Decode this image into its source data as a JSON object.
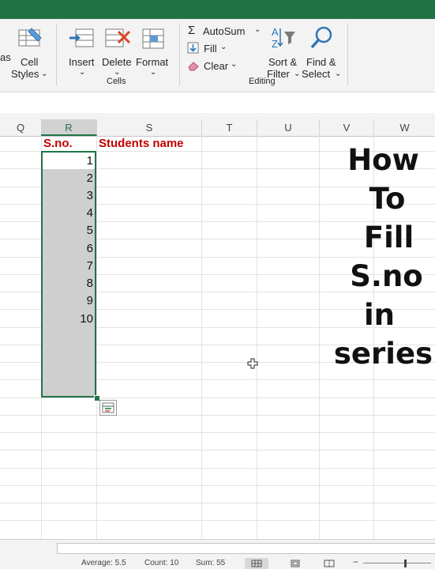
{
  "ribbon": {
    "cell_styles": {
      "line1": "Cell",
      "line2": "Styles"
    },
    "partial_left": "as",
    "insert": "Insert",
    "delete": "Delete",
    "format": "Format",
    "cells_group": "Cells",
    "autosum": "AutoSum",
    "fill": "Fill",
    "clear": "Clear",
    "sort_filter": {
      "line1": "Sort &",
      "line2": "Filter"
    },
    "find_select": {
      "line1": "Find &",
      "line2": "Select"
    },
    "editing_group": "Editing"
  },
  "columns": [
    "Q",
    "R",
    "S",
    "T",
    "U",
    "V",
    "W"
  ],
  "sheet": {
    "header_sno": "S.no.",
    "header_name": "Students name",
    "serials": [
      "1",
      "2",
      "3",
      "4",
      "5",
      "6",
      "7",
      "8",
      "9",
      "10"
    ]
  },
  "overlay": [
    "How",
    "To",
    "Fill",
    "S.no",
    "in",
    "series"
  ],
  "status": {
    "average": "Average: 5.5",
    "count": "Count: 10",
    "sum": "Sum: 55"
  },
  "colors": {
    "accent": "#217346",
    "header_red": "#c00000"
  }
}
